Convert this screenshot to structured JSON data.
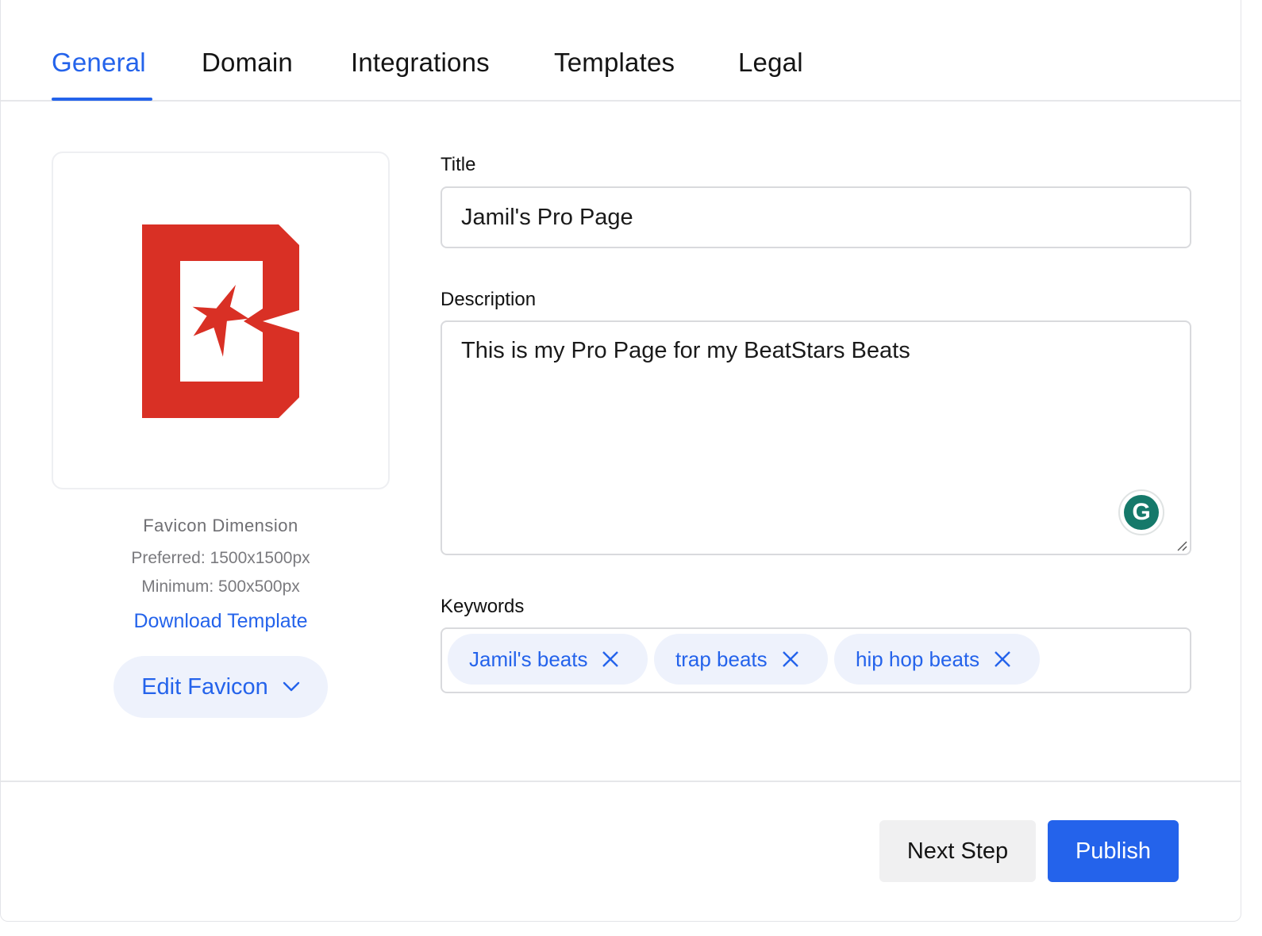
{
  "tabs": [
    {
      "label": "General",
      "active": true
    },
    {
      "label": "Domain"
    },
    {
      "label": "Integrations"
    },
    {
      "label": "Templates"
    },
    {
      "label": "Legal"
    }
  ],
  "favicon": {
    "logo_icon": "beatstars-logo",
    "dimension_title": "Favicon Dimension",
    "preferred": "Preferred: 1500x1500px",
    "minimum": "Minimum: 500x500px",
    "download_label": "Download Template",
    "edit_label": "Edit Favicon"
  },
  "form": {
    "title_label": "Title",
    "title_value": "Jamil's Pro Page",
    "description_label": "Description",
    "description_value": "This is my Pro Page for my BeatStars Beats",
    "keywords_label": "Keywords",
    "keywords": [
      "Jamil's beats",
      "trap beats",
      "hip hop beats"
    ]
  },
  "grammarly_icon": "grammarly-icon",
  "footer": {
    "next_label": "Next Step",
    "publish_label": "Publish"
  },
  "colors": {
    "accent": "#2463eb",
    "logo_red": "#d93025",
    "chip_bg": "#eef2fc"
  }
}
